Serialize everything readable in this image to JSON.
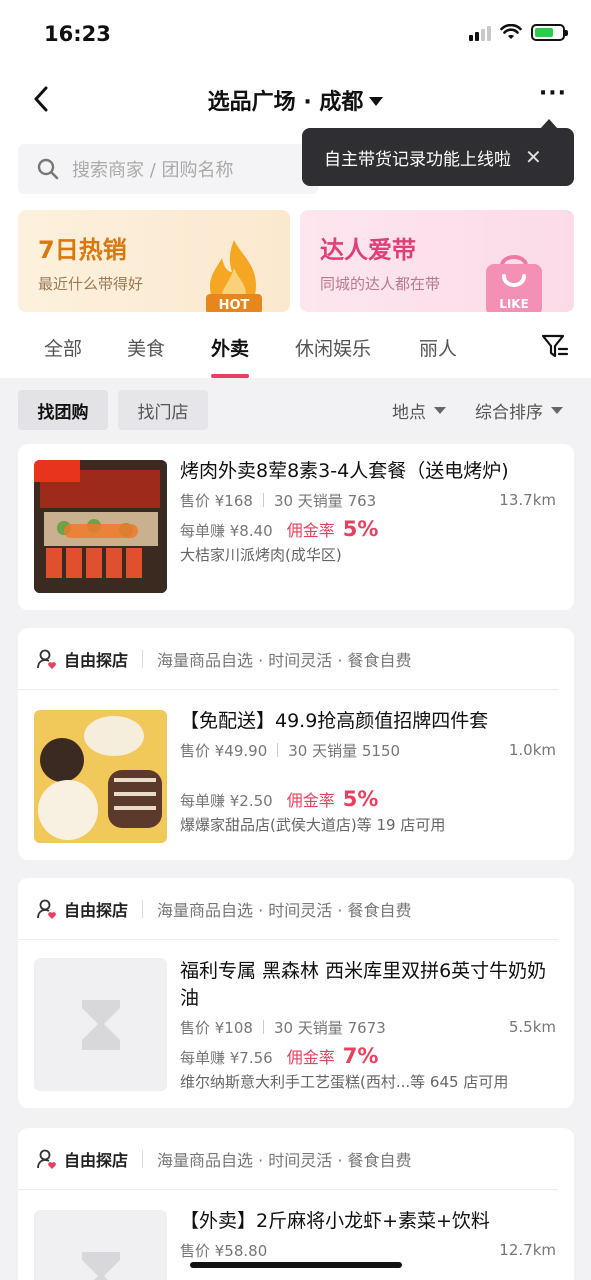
{
  "status": {
    "time": "16:23"
  },
  "nav": {
    "title": "选品广场 · 成都",
    "more": "···"
  },
  "search": {
    "placeholder": "搜索商家 / 团购名称"
  },
  "tooltip": {
    "text": "自主带货记录功能上线啦",
    "close": "✕"
  },
  "banners": [
    {
      "title": "7日热销",
      "subtitle": "最近什么带得好",
      "badge": "HOT"
    },
    {
      "title": "达人爱带",
      "subtitle": "同城的达人都在带",
      "badge": "LIKE"
    }
  ],
  "tabs": [
    "全部",
    "美食",
    "外卖",
    "休闲娱乐",
    "丽人"
  ],
  "active_tab": "外卖",
  "filters": {
    "chips": [
      "找团购",
      "找门店"
    ],
    "sort": [
      "地点",
      "综合排序"
    ]
  },
  "section_header": {
    "title": "自由探店",
    "desc": "海量商品自选 · 时间灵活 · 餐食自费"
  },
  "products": [
    {
      "title": "烤肉外卖8荤8素3-4人套餐（送电烤炉)",
      "price": "售价 ¥168",
      "sales": "30 天销量 763",
      "distance": "13.7km",
      "earn": "每单赚 ¥8.40",
      "rate_label": "佣金率",
      "rate": "5%",
      "shop": "大桔家川派烤肉(成华区)"
    },
    {
      "title": "【免配送】49.9抢高颜值招牌四件套",
      "price": "售价 ¥49.90",
      "sales": "30 天销量 5150",
      "distance": "1.0km",
      "earn": "每单赚 ¥2.50",
      "rate_label": "佣金率",
      "rate": "5%",
      "shop": "爆爆家甜品店(武侯大道店)等 19 店可用"
    },
    {
      "title": "福利专属 黑森林 西米库里双拼6英寸牛奶奶油",
      "price": "售价 ¥108",
      "sales": "30 天销量 7673",
      "distance": "5.5km",
      "earn": "每单赚 ¥7.56",
      "rate_label": "佣金率",
      "rate": "7%",
      "shop": "维尔纳斯意大利手工艺蛋糕(西村...等 645 店可用"
    },
    {
      "title": "【外卖】2斤麻将小龙虾+素菜+饮料",
      "price": "售价 ¥58.80",
      "distance": "12.7km"
    }
  ],
  "colors": {
    "accent": "#e8415f",
    "hot": "#d9780e",
    "like": "#e23f79"
  }
}
